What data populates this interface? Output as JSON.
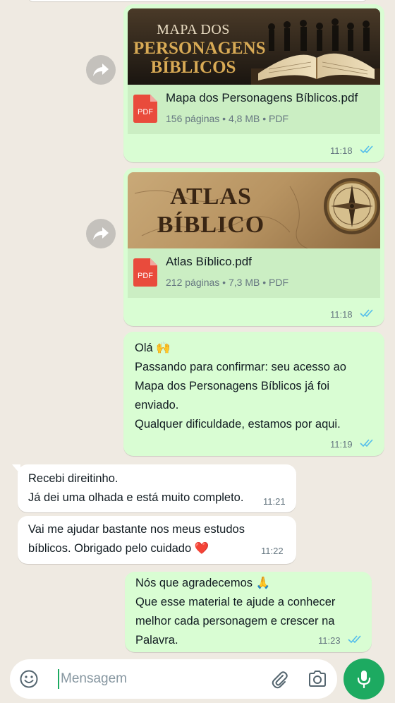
{
  "messages": {
    "doc1": {
      "thumb_title_line1": "MAPA DOS",
      "thumb_title_line2": "PERSONAGENS",
      "thumb_title_line3": "BÍBLICOS",
      "file_name": "Mapa dos Personagens Bíblicos.pdf",
      "file_meta": "156 páginas • 4,8 MB • PDF",
      "file_type": "PDF",
      "time": "11:18"
    },
    "doc2": {
      "thumb_title_line1": "ATLAS",
      "thumb_title_line2": "BÍBLICO",
      "file_name": "Atlas Bíblico.pdf",
      "file_meta": "212 páginas • 7,3 MB • PDF",
      "file_type": "PDF",
      "time": "11:18"
    },
    "out1": {
      "lines": [
        "Olá 🙌",
        "Passando para confirmar: seu acesso ao",
        "Mapa dos Personagens Bíblicos já foi",
        "enviado.",
        "Qualquer dificuldade, estamos por aqui."
      ],
      "time": "11:19"
    },
    "in1": {
      "lines": [
        "Recebi direitinho.",
        "Já dei uma olhada e está muito completo."
      ],
      "time": "11:21"
    },
    "in2": {
      "lines": [
        "Vai me ajudar bastante nos meus estudos",
        "bíblicos. Obrigado pelo cuidado ❤️"
      ],
      "time": "11:22"
    },
    "out2": {
      "lines": [
        "Nós que agradecemos 🙏",
        "Que esse material te ajude a conhecer",
        "melhor cada personagem e crescer na",
        "Palavra."
      ],
      "time": "11:23"
    }
  },
  "input": {
    "placeholder": "Mensagem"
  },
  "icons": {
    "forward": "forward-icon",
    "pdf": "pdf-file-icon",
    "read_receipt": "double-check-icon",
    "emoji": "emoji-icon",
    "attach": "paperclip-icon",
    "camera": "camera-icon",
    "mic": "microphone-icon"
  },
  "colors": {
    "background": "#efeae2",
    "outgoing_bubble": "#d9fdd3",
    "incoming_bubble": "#ffffff",
    "read_tick": "#53bdeb",
    "accent": "#1daa61",
    "pdf_red": "#e94b3c"
  }
}
